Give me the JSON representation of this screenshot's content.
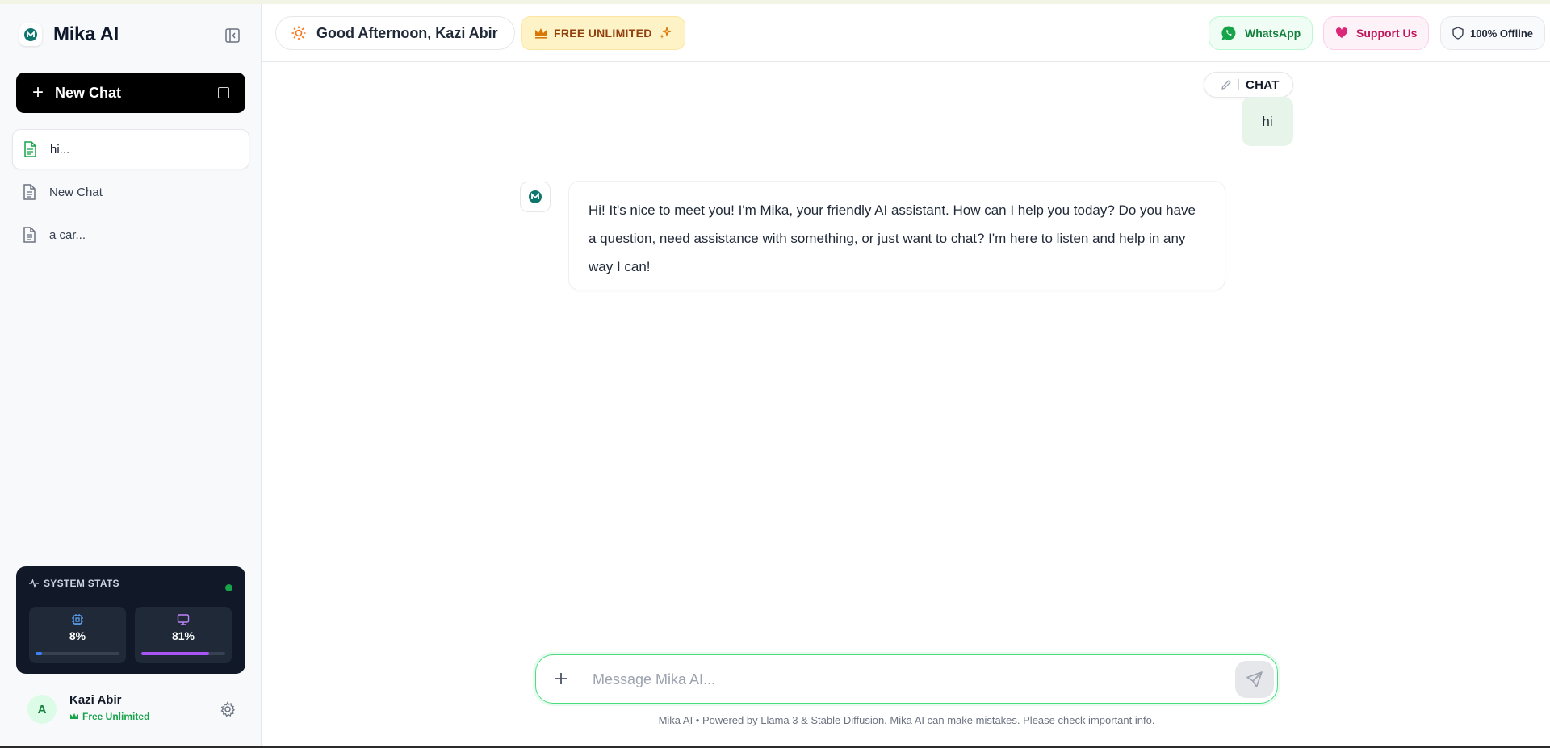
{
  "app": {
    "name": "Mika AI"
  },
  "sidebar": {
    "new_chat_label": "New Chat",
    "history": [
      {
        "label": "hi...",
        "active": true
      },
      {
        "label": "New Chat",
        "active": false
      },
      {
        "label": "a car...",
        "active": false
      }
    ],
    "stats": {
      "title": "SYSTEM STATS",
      "cpu": {
        "label": "8%",
        "value": 0.08,
        "color": "#3b82f6",
        "icon": "cpu-icon"
      },
      "gpu": {
        "label": "81%",
        "value": 0.81,
        "color": "#a855f7",
        "icon": "monitor-icon"
      }
    },
    "user": {
      "initial": "A",
      "name": "Kazi Abir",
      "plan": "Free Unlimited"
    }
  },
  "header": {
    "greeting": "Good Afternoon, Kazi Abir",
    "plan_badge": "FREE UNLIMITED",
    "whatsapp": "WhatsApp",
    "support": "Support Us",
    "offline": "100% Offline"
  },
  "chat": {
    "mode": "CHAT",
    "user_message": "hi",
    "assistant_message": "Hi! It's nice to meet you! I'm Mika, your friendly AI assistant. How can I help you today? Do you have a question, need assistance with something, or just want to chat? I'm here to listen and help in any way I can!"
  },
  "composer": {
    "placeholder": "Message Mika AI...",
    "footer": "Mika AI • Powered by Llama 3 & Stable Diffusion. Mika AI can make mistakes. Please check important info."
  },
  "colors": {
    "accent": "#16a34a",
    "brand": "#0f766e"
  }
}
